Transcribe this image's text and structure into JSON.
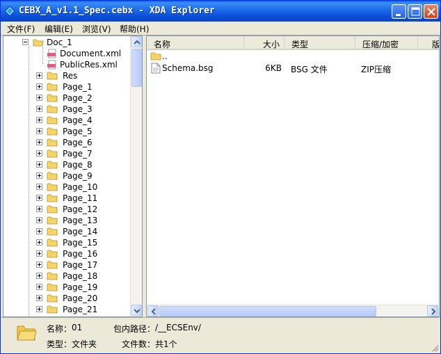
{
  "window": {
    "title": "CEBX_A_v1.1_Spec.cebx - XDA Explorer"
  },
  "menu": {
    "items": [
      {
        "label": "文件(F)"
      },
      {
        "label": "编辑(E)"
      },
      {
        "label": "浏览(V)"
      },
      {
        "label": "帮助(H)"
      }
    ]
  },
  "tree": {
    "root": "Doc_1",
    "files": [
      "Document.xml",
      "PublicRes.xml"
    ],
    "folders": [
      "Res",
      "Page_1",
      "Page_2",
      "Page_3",
      "Page_4",
      "Page_5",
      "Page_6",
      "Page_7",
      "Page_8",
      "Page_9",
      "Page_10",
      "Page_11",
      "Page_12",
      "Page_13",
      "Page_14",
      "Page_15",
      "Page_16",
      "Page_17",
      "Page_18",
      "Page_19",
      "Page_20",
      "Page_21"
    ]
  },
  "list": {
    "columns": [
      "名称",
      "大小",
      "类型",
      "压缩/加密",
      "版"
    ],
    "rows": [
      {
        "name": "..",
        "size": "",
        "type": "",
        "compression": "",
        "icon": "folder-icon"
      },
      {
        "name": "Schema.bsg",
        "size": "6KB",
        "type": "BSG 文件",
        "compression": "ZIP压缩",
        "icon": "file-icon"
      }
    ]
  },
  "status": {
    "name_label": "名称：",
    "name_value": "01",
    "path_label": "包内路径：",
    "path_value": "/__ECSEnv/",
    "type_label": "类型：",
    "type_value": "文件夹",
    "count_label": "文件数：",
    "count_value": "共1个"
  },
  "colors": {
    "titlebar": "#0a4fd8",
    "folder": "#f5d56a",
    "selection": "#316ac5"
  }
}
